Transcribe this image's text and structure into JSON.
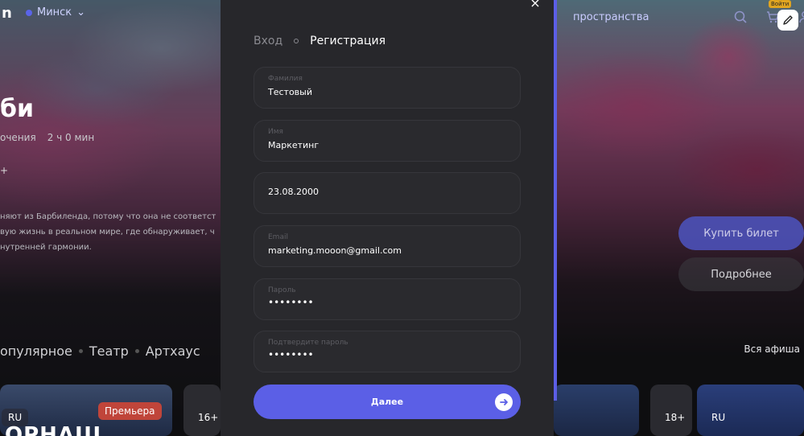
{
  "header": {
    "city": "Минск",
    "spaces_link": "пространства",
    "soon_badge": "Войти"
  },
  "hero": {
    "title_fragment": "би",
    "meta_fragment": "очения",
    "duration": "2 ч 0 мин",
    "age_fragment": "+",
    "description_lines": [
      "няют из Барбиленда, потому что она не соответст",
      "вую жизнь в реальном мире, где обнаруживает, ч",
      "нутренней гармонии."
    ],
    "buy_label": "Купить билет",
    "more_label": "Подробнее"
  },
  "categories": {
    "items": [
      "опулярное",
      "Театр",
      "Артхаус"
    ],
    "all_label": "Вся афиша"
  },
  "cards": {
    "card1_lang": "RU",
    "card1_badge": "Премьера",
    "card1_title": "ОРНАШ",
    "card2_age": "16+",
    "card4_age": "18+",
    "card5_lang": "RU"
  },
  "modal": {
    "tab_login": "Вход",
    "tab_register": "Регистрация",
    "fields": [
      {
        "label": "Фамилия",
        "value": "Тестовый"
      },
      {
        "label": "Имя",
        "value": "Маркетинг"
      },
      {
        "label": "",
        "value": "23.08.2000"
      },
      {
        "label": "Email",
        "value": "marketing.mooon@gmail.com"
      },
      {
        "label": "Пароль",
        "value": "••••••••"
      },
      {
        "label": "Подтвердите пароль",
        "value": "••••••••"
      }
    ],
    "next_label": "Далее",
    "close_label": "×"
  },
  "colors": {
    "accent": "#5b5fe6",
    "modal_bg": "#27272b",
    "premiere": "#c0453a"
  }
}
